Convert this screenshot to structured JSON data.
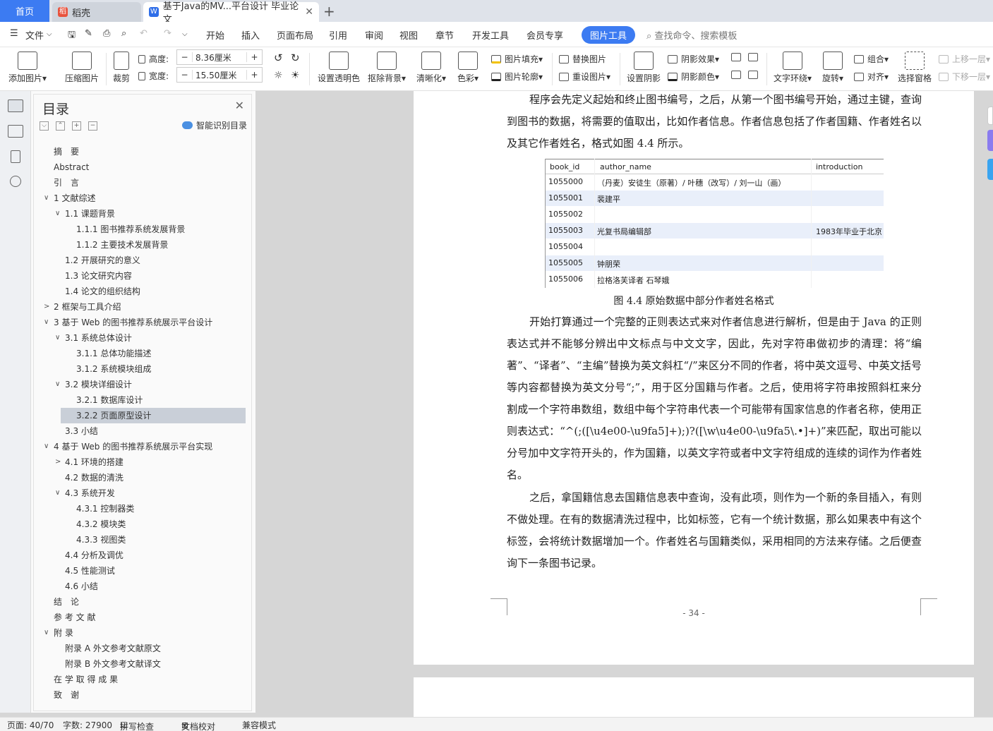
{
  "tabs": {
    "home": "首页",
    "daoke": "稻壳",
    "doc": "基于Java的MV...平台设计 毕业论文"
  },
  "menu": {
    "file": "文件",
    "items": [
      "开始",
      "插入",
      "页面布局",
      "引用",
      "审阅",
      "视图",
      "章节",
      "开发工具",
      "会员专享"
    ],
    "active": "图片工具",
    "search": "查找命令、搜索模板"
  },
  "ribbon": {
    "add_picture": "添加图片",
    "compress": "压缩图片",
    "crop": "裁剪",
    "height_label": "高度:",
    "height_value": "8.36厘米",
    "width_label": "宽度:",
    "width_value": "15.50厘米",
    "set_transparent": "设置透明色",
    "remove_bg": "抠除背景",
    "sharpen": "清晰化",
    "color": "色彩",
    "picture_fill": "图片填充",
    "picture_outline": "图片轮廓",
    "replace_picture": "替换图片",
    "reset_picture": "重设图片",
    "set_shadow": "设置阴影",
    "shadow_effect": "阴影效果",
    "shadow_color": "阴影颜色",
    "text_wrap": "文字环绕",
    "rotate": "旋转",
    "group": "组合",
    "align": "对齐",
    "selection_pane": "选择窗格",
    "bring_forward": "上移一层",
    "send_backward": "下移一层"
  },
  "toc": {
    "title": "目录",
    "smart": "智能识别目录",
    "items": [
      "摘　要",
      "Abstract",
      "引　言",
      "1  文献综述",
      "1.1  课题背景",
      "1.1.1  图书推荐系统发展背景",
      "1.1.2  主要技术发展背景",
      "1.2  开展研究的意义",
      "1.3  论文研究内容",
      "1.4  论文的组织结构",
      "2  框架与工具介绍",
      "3  基于 Web 的图书推荐系统展示平台设计",
      "3.1  系统总体设计",
      "3.1.1  总体功能描述",
      "3.1.2  系统模块组成",
      "3.2  模块详细设计",
      "3.2.1  数据库设计",
      "3.2.2  页面原型设计",
      "3.3  小结",
      "4  基于 Web 的图书推荐系统展示平台实现",
      "4.1  环境的搭建",
      "4.2  数据的清洗",
      "4.3  系统开发",
      "4.3.1  控制器类",
      "4.3.2  模块类",
      "4.3.3  视图类",
      "4.4  分析及调优",
      "4.5  性能测试",
      "4.6  小结",
      "结　论",
      "参 考 文 献",
      "附 录",
      "附录 A  外文参考文献原文",
      "附录 B  外文参考文献译文",
      "在 学 取 得 成 果",
      "致　谢"
    ]
  },
  "document": {
    "para1": "程序会先定义起始和终止图书编号，之后，从第一个图书编号开始，通过主键，查询到图书的数据，将需要的值取出，比如作者信息。作者信息包括了作者国籍、作者姓名以及其它作者姓名，格式如图 4.4 所示。",
    "table": {
      "headers": [
        "book_id",
        "author_name",
        "introduction"
      ],
      "rows": [
        [
          "1055000",
          "（丹麦）安徒生（原著）/ 叶穗（改写）/ 刘一山（画）",
          ""
        ],
        [
          "1055001",
          "裴建平",
          ""
        ],
        [
          "1055002",
          "",
          ""
        ],
        [
          "1055003",
          "光复书局编辑部",
          "1983年毕业于北京"
        ],
        [
          "1055004",
          "",
          ""
        ],
        [
          "1055005",
          "钟朋荣",
          ""
        ],
        [
          "1055006",
          "拉格洛芙译者 石琴娥",
          ""
        ]
      ]
    },
    "caption": "图 4.4 原始数据中部分作者姓名格式",
    "para2": "开始打算通过一个完整的正则表达式来对作者信息进行解析，但是由于 Java 的正则表达式并不能够分辨出中文标点与中文文字，因此，先对字符串做初步的清理：将“编著”、“译者”、“主编”替换为英文斜杠“/”来区分不同的作者，将中英文逗号、中英文括号等内容都替换为英文分号“;”，用于区分国籍与作者。之后，使用将字符串按照斜杠来分割成一个字符串数组，数组中每个字符串代表一个可能带有国家信息的作者名称，使用正则表达式：“^(;([\\u4e00-\\u9fa5]+);)?([\\w\\u4e00-\\u9fa5\\.•]+)”来匹配，取出可能以分号加中文字符开头的，作为国籍，以英文字符或者中文字符组成的连续的词作为作者姓名。",
    "para3": "之后，拿国籍信息去国籍信息表中查询，没有此项，则作为一个新的条目插入，有则不做处理。在有的数据清洗过程中，比如标签，它有一个统计数据，那么如果表中有这个标签，会将统计数据增加一个。作者姓名与国籍类似，采用相同的方法来存储。之后便查询下一条图书记录。",
    "page_number": "- 34 -"
  },
  "status": {
    "page": "页面: 40/70",
    "words": "字数: 27900",
    "spell": "拼写检查",
    "proof": "文档校对",
    "compat": "兼容模式"
  }
}
